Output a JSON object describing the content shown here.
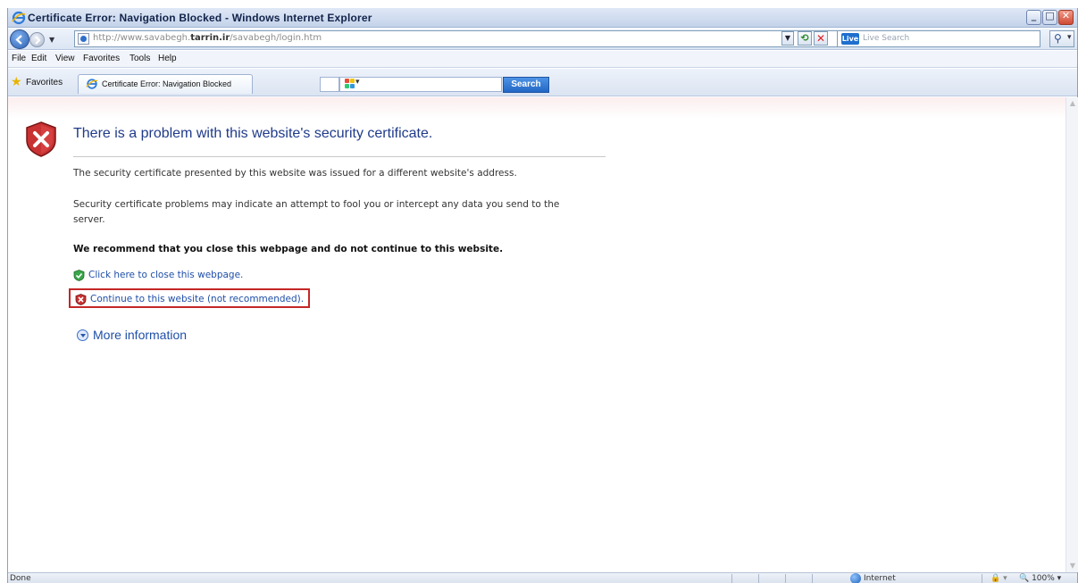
{
  "window": {
    "title": "Certificate Error: Navigation Blocked - Windows Internet Explorer",
    "minimize": "_",
    "maximize": "□",
    "close": "✕"
  },
  "address_bar": {
    "url_prefix": "http://www.savabegh.",
    "url_domain": "tarrin.ir",
    "url_suffix": "/savabegh/login.htm",
    "search_placeholder": "Live Search",
    "live_icon_text": "Live"
  },
  "menu": [
    "File",
    "Edit",
    "View",
    "Favorites",
    "Tools",
    "Help"
  ],
  "favorites_bar": {
    "favorites_label": "Favorites",
    "tab_label": "Certificate Error: Navigation Blocked",
    "search_button": "Search"
  },
  "error_page": {
    "title": "There is a problem with this website's security certificate.",
    "p1": "The security certificate presented by this website was issued for a different website's address.",
    "p2": "Security certificate problems may indicate an attempt to fool you or intercept any data you send to the server.",
    "recommend": "We recommend that you close this webpage and do not continue to this website.",
    "close_link": "Click here to close this webpage.",
    "continue_link": "Continue to this website (not recommended).",
    "more_info": "More information"
  },
  "status_bar": {
    "status": "Done",
    "zone": "Internet",
    "protected": "🔒 ▾",
    "zoom": "🔍 100%  ▾"
  },
  "colors": {
    "link": "#1f4fa8",
    "title_blue": "#1f3b8a",
    "highlight_box": "#c52626",
    "search_button": "#2367c5"
  },
  "icons": [
    "ie-logo-icon",
    "back-icon",
    "forward-icon",
    "refresh-icon",
    "stop-icon",
    "search-icon",
    "favorites-star-icon",
    "shield-error-icon",
    "shield-ok-icon",
    "shield-warn-icon",
    "expand-circle-icon",
    "globe-icon"
  ]
}
